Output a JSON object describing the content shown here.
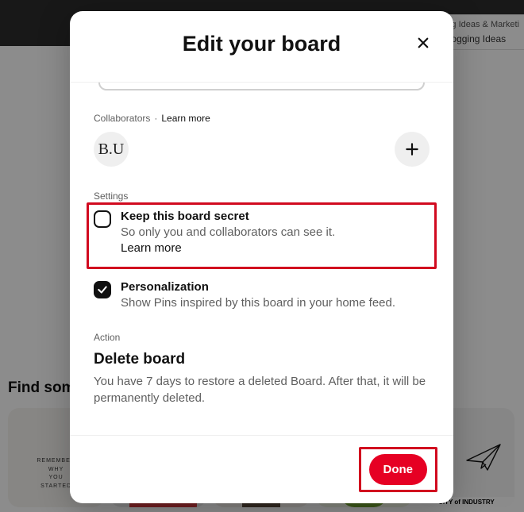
{
  "topbar": {
    "line1": "g Ideas & Marketi",
    "line2": "ogging Ideas"
  },
  "background": {
    "heading": "Find some",
    "card1_text": "REMEMBER\nWHY\nYOU\nSTARTED",
    "card5_text": "CITY of INDUSTRY"
  },
  "modal": {
    "title": "Edit your board",
    "collaborators_label": "Collaborators",
    "learn_more": "Learn more",
    "avatar_initials": "B.U",
    "settings_label": "Settings",
    "secret": {
      "title": "Keep this board secret",
      "sub_prefix": "So only you and collaborators can see it. ",
      "learn_more": "Learn more"
    },
    "personalization": {
      "title": "Personalization",
      "sub": "Show Pins inspired by this board in your home feed."
    },
    "action_label": "Action",
    "delete": {
      "title": "Delete board",
      "sub": "You have 7 days to restore a deleted Board. After that, it will be permanently deleted."
    },
    "done": "Done"
  }
}
